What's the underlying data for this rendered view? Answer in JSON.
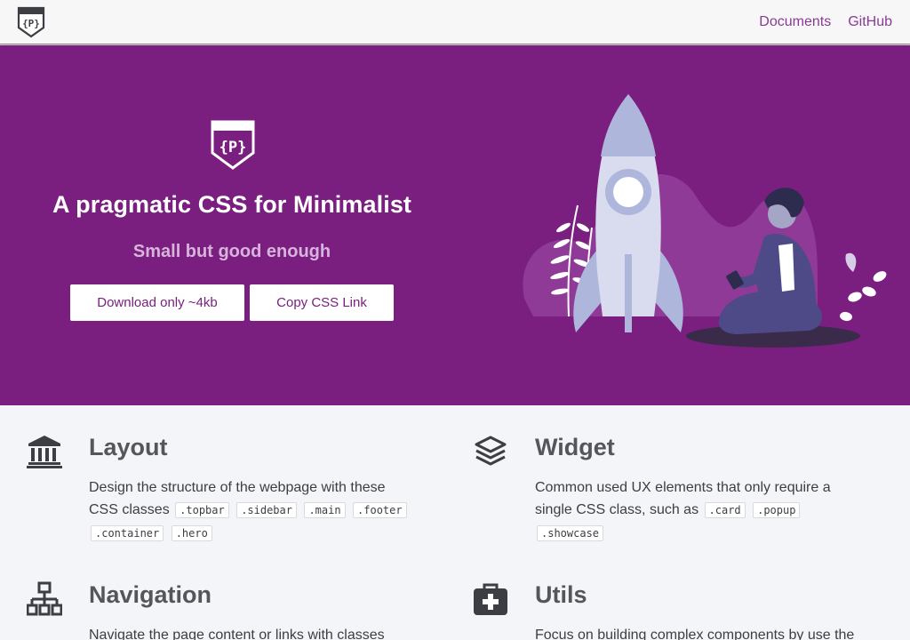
{
  "topbar": {
    "logo_icon": "curly-braces-shield-logo-icon",
    "nav": [
      {
        "label": "Documents"
      },
      {
        "label": "GitHub"
      }
    ]
  },
  "hero": {
    "logo_icon": "curly-braces-shield-logo-icon",
    "title": "A pragmatic CSS for Minimalist",
    "subtitle": "Small but good enough",
    "download_label": "Download only ~4kb",
    "copy_label": "Copy CSS Link",
    "illustration": "rocket-and-person-illustration",
    "colors": {
      "background": "#7a1f80",
      "subtitle": "#d8b4dc",
      "button_text": "#7a1f80"
    }
  },
  "features": {
    "layout": {
      "icon": "columns-building-icon",
      "title": "Layout",
      "text": "Design the structure of the webpage with these CSS classes",
      "classes": [
        ".topbar",
        ".sidebar",
        ".main",
        ".footer",
        ".container",
        ".hero"
      ]
    },
    "widget": {
      "icon": "layers-icon",
      "title": "Widget",
      "text": "Common used UX elements that only require a single CSS class, such as",
      "classes": [
        ".card",
        ".popup",
        ".showcase"
      ]
    },
    "navigation": {
      "icon": "sitemap-icon",
      "title": "Navigation",
      "text": "Navigate the page content or links with classes"
    },
    "utils": {
      "icon": "medkit-icon",
      "title": "Utils",
      "text": "Focus on building complex components by use the"
    }
  }
}
